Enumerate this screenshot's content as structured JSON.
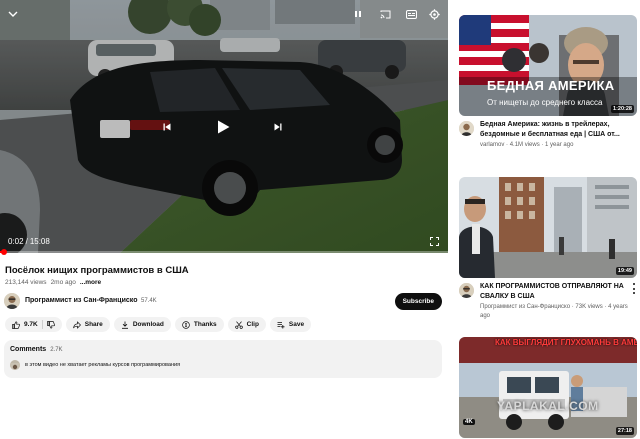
{
  "player": {
    "current_time": "0:02",
    "separator": "/",
    "duration": "15:08",
    "progress": 0.002,
    "icons": [
      "collapse-icon",
      "pause-icon",
      "cast-icon",
      "captions-icon",
      "settings-icon",
      "previous-icon",
      "play-icon",
      "next-icon",
      "fullscreen-icon"
    ]
  },
  "video": {
    "title": "Посёлок нищих программистов в США",
    "views": "213,144 views",
    "age": "2mo ago",
    "more": "...more"
  },
  "channel": {
    "name": "Программист из Сан-Франциско",
    "subscribers": "57.4K",
    "subscribe_label": "Subscribe"
  },
  "actions": {
    "like_count": "9.7K",
    "share": "Share",
    "download": "Download",
    "thanks": "Thanks",
    "clip": "Clip",
    "save": "Save"
  },
  "comments": {
    "label": "Comments",
    "count": "2.7K",
    "top_comment": "в этом видео не хватает рекламы курсов программирования"
  },
  "sidebar": {
    "items": [
      {
        "thumb_title": "БЕДНАЯ АМЕРИКА",
        "thumb_subtitle": "От нищеты до среднего класса",
        "duration": "1:20:28",
        "title": "Бедная Америка: жизнь в трейлерах, бездомные и бесплатная еда | США от...",
        "channel": "varlamov",
        "views": "4.1M views",
        "age": "1 year ago"
      },
      {
        "thumb_title": "",
        "duration": "19:49",
        "title": "КАК ПРОГРАММИСТОВ ОТПРАВЛЯЮТ НА СВАЛКУ В США",
        "channel": "Программист из Сан-Франциско",
        "views": "73K views",
        "age": "4 years ago"
      },
      {
        "thumb_title": "КАК ВЫГЛЯДИТ ГЛУХОМАНЬ В АМЕРИКЕ",
        "watermark": "YAPLAKAL.COM",
        "badge": "4K",
        "duration": "27:18"
      }
    ]
  },
  "colors": {
    "accent_red": "#ff0000",
    "pill_bg": "#f2f2f2",
    "subscribe_bg": "#0f0f0f",
    "thumb_red": "#c8102e"
  }
}
